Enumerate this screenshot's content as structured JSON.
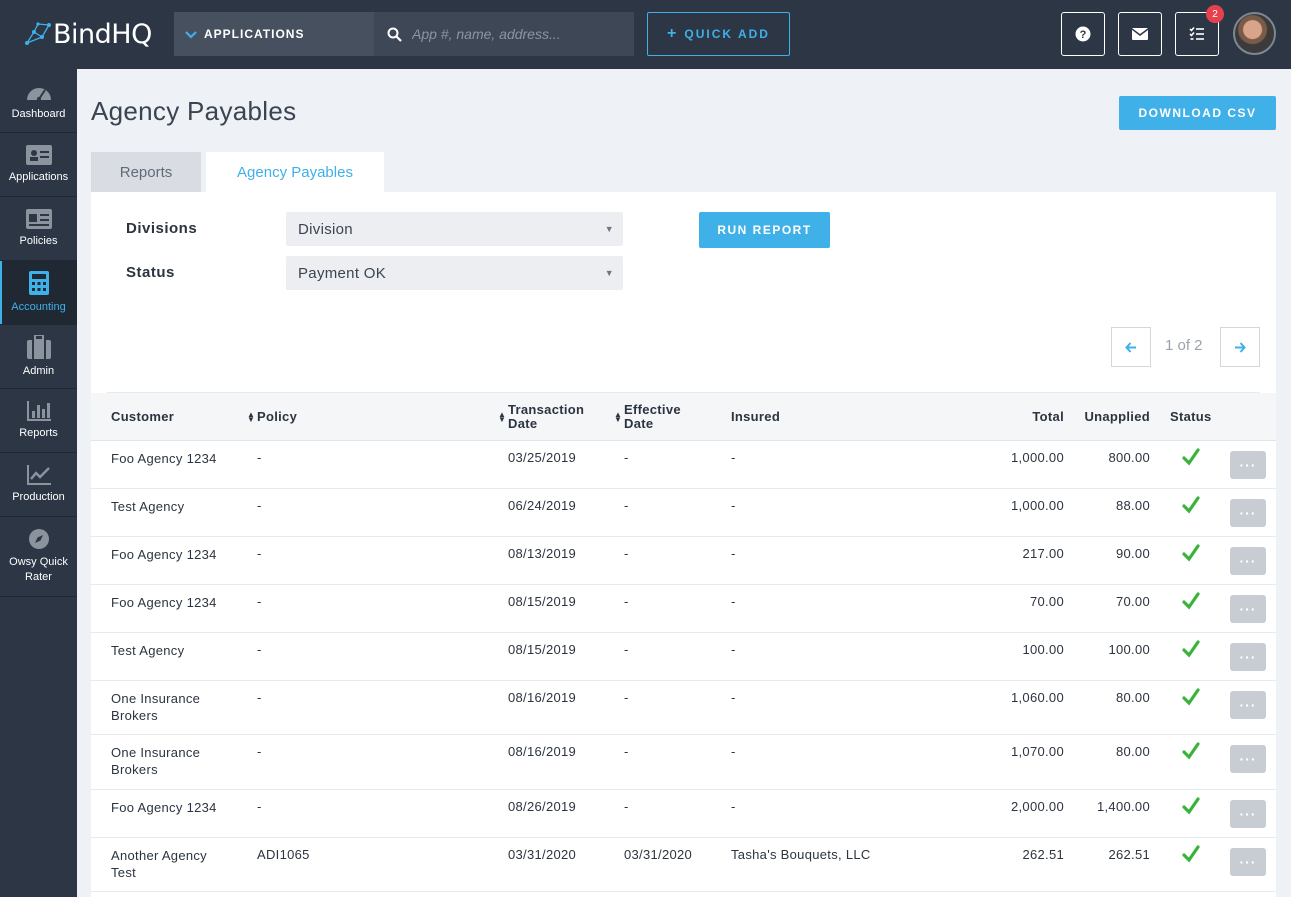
{
  "brand": {
    "name": "BindHQ",
    "accent": "#3fb0e8",
    "nav_bg": "#2c3645"
  },
  "topbar": {
    "app_dropdown": "APPLICATIONS",
    "search_placeholder": "App #, name, address...",
    "quick_add": "QUICK ADD",
    "notification_count": "2",
    "icons": [
      "question-icon",
      "mail-icon",
      "tasks-icon"
    ]
  },
  "sidebar": {
    "items": [
      {
        "label": "Dashboard",
        "icon": "dashboard-gauge-icon"
      },
      {
        "label": "Applications",
        "icon": "id-card-icon"
      },
      {
        "label": "Policies",
        "icon": "policy-card-icon"
      },
      {
        "label": "Accounting",
        "icon": "calculator-icon",
        "active": true
      },
      {
        "label": "Admin",
        "icon": "briefcase-icon"
      },
      {
        "label": "Reports",
        "icon": "bar-chart-icon"
      },
      {
        "label": "Production",
        "icon": "line-chart-icon"
      },
      {
        "label": "Owsy Quick Rater",
        "icon": "compass-icon"
      }
    ]
  },
  "page": {
    "title": "Agency Payables",
    "download_csv": "DOWNLOAD CSV",
    "tabs": [
      {
        "label": "Reports",
        "active": false
      },
      {
        "label": "Agency Payables",
        "active": true
      }
    ]
  },
  "filters": {
    "divisions_label": "Divisions",
    "divisions_value": "Division",
    "status_label": "Status",
    "status_value": "Payment OK",
    "run_report": "RUN REPORT"
  },
  "pager": {
    "text": "1 of 2"
  },
  "table": {
    "columns": {
      "customer": "Customer",
      "policy": "Policy",
      "transaction_date_1": "Transaction",
      "transaction_date_2": "Date",
      "effective_date_1": "Effective",
      "effective_date_2": "Date",
      "insured": "Insured",
      "total": "Total",
      "unapplied": "Unapplied",
      "status": "Status"
    },
    "rows": [
      {
        "customer": "Foo Agency 1234",
        "policy": "-",
        "transaction_date": "03/25/2019",
        "effective_date": "-",
        "insured": "-",
        "total": "1,000.00",
        "unapplied": "800.00",
        "status": "ok"
      },
      {
        "customer": "Test Agency",
        "policy": "-",
        "transaction_date": "06/24/2019",
        "effective_date": "-",
        "insured": "-",
        "total": "1,000.00",
        "unapplied": "88.00",
        "status": "ok"
      },
      {
        "customer": "Foo Agency 1234",
        "policy": "-",
        "transaction_date": "08/13/2019",
        "effective_date": "-",
        "insured": "-",
        "total": "217.00",
        "unapplied": "90.00",
        "status": "ok"
      },
      {
        "customer": "Foo Agency 1234",
        "policy": "-",
        "transaction_date": "08/15/2019",
        "effective_date": "-",
        "insured": "-",
        "total": "70.00",
        "unapplied": "70.00",
        "status": "ok"
      },
      {
        "customer": "Test Agency",
        "policy": "-",
        "transaction_date": "08/15/2019",
        "effective_date": "-",
        "insured": "-",
        "total": "100.00",
        "unapplied": "100.00",
        "status": "ok"
      },
      {
        "customer": "One Insurance Brokers",
        "policy": "-",
        "transaction_date": "08/16/2019",
        "effective_date": "-",
        "insured": "-",
        "total": "1,060.00",
        "unapplied": "80.00",
        "status": "ok"
      },
      {
        "customer": "One Insurance Brokers",
        "policy": "-",
        "transaction_date": "08/16/2019",
        "effective_date": "-",
        "insured": "-",
        "total": "1,070.00",
        "unapplied": "80.00",
        "status": "ok"
      },
      {
        "customer": "Foo Agency 1234",
        "policy": "-",
        "transaction_date": "08/26/2019",
        "effective_date": "-",
        "insured": "-",
        "total": "2,000.00",
        "unapplied": "1,400.00",
        "status": "ok"
      },
      {
        "customer": "Another Agency Test",
        "policy": "ADI1065",
        "transaction_date": "03/31/2020",
        "effective_date": "03/31/2020",
        "insured": "Tasha's Bouquets, LLC",
        "total": "262.51",
        "unapplied": "262.51",
        "status": "ok"
      }
    ]
  }
}
